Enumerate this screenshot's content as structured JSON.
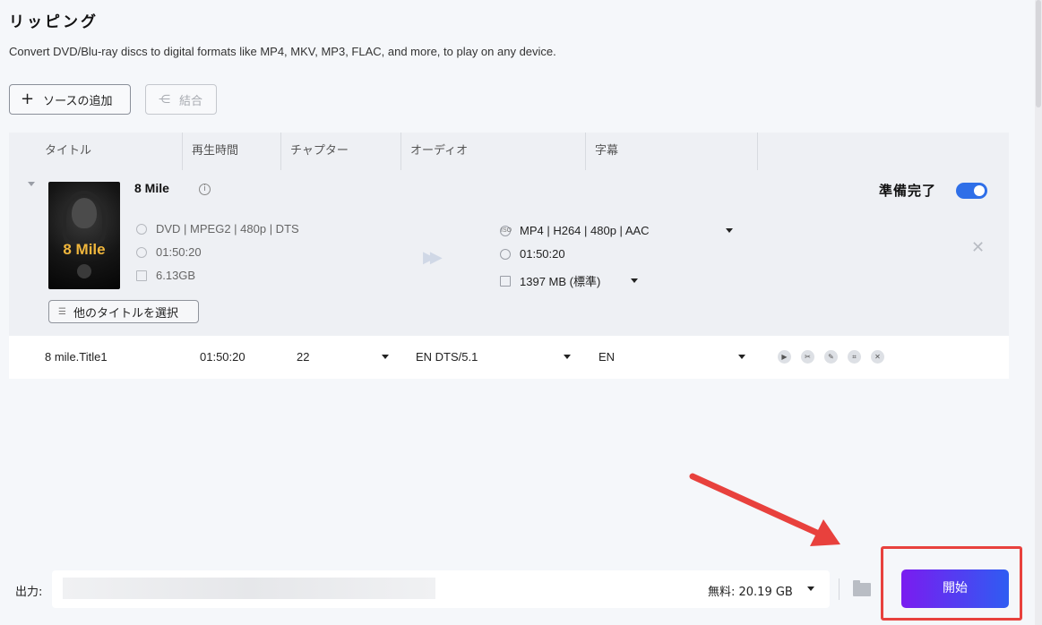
{
  "page": {
    "title": "リッピング",
    "description": "Convert DVD/Blu-ray discs to digital formats like MP4, MKV, MP3, FLAC, and more, to play on any device."
  },
  "toolbar": {
    "add_source_icon": "+",
    "add_source_label": "ソースの追加",
    "merge_label": "結合"
  },
  "table": {
    "headers": [
      "タイトル",
      "再生時間",
      "チャプター",
      "オーディオ",
      "字幕"
    ]
  },
  "item": {
    "title": "8 Mile",
    "poster_text": "8 Mile",
    "source": {
      "format": "DVD | MPEG2 | 480p | DTS",
      "duration": "01:50:20",
      "size": "6.13GB"
    },
    "output": {
      "format": "MP4 | H264 | 480p | AAC",
      "duration": "01:50:20",
      "size": "1397 MB (標準)"
    },
    "ready_label": "準備完了",
    "ready_enabled": true,
    "select_titles_label": "他のタイトルを選択"
  },
  "track": {
    "title": "8 mile.Title1",
    "duration": "01:50:20",
    "chapters": "22",
    "audio": "EN  DTS/5.1",
    "subtitle": "EN"
  },
  "footer": {
    "output_label": "出力:",
    "free_space": "無料:  20.19 GB",
    "start_label": "開始"
  },
  "colors": {
    "accent": "#2f6fe8",
    "start_gradient_from": "#7a1cf0",
    "start_gradient_to": "#2f5cf2",
    "annotation": "#e8413d"
  }
}
